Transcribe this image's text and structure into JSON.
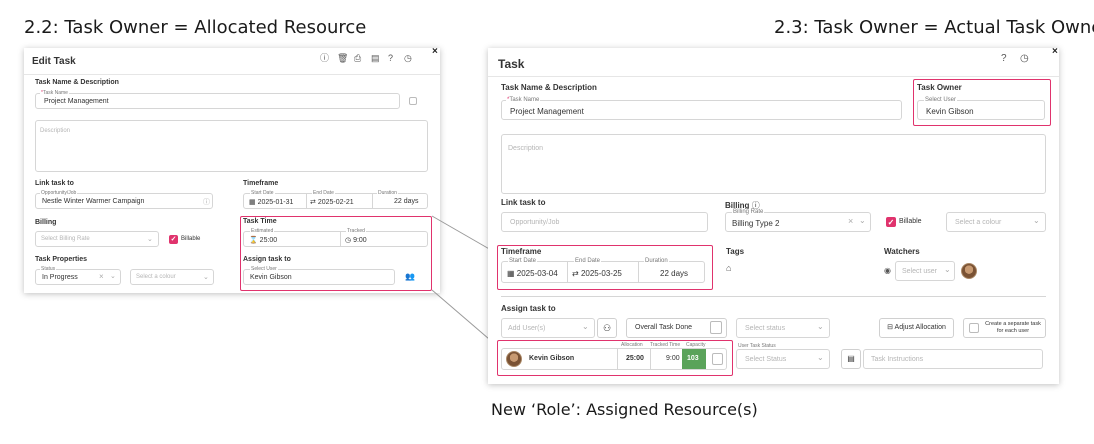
{
  "headings": {
    "left": "2.2: Task Owner = Allocated Resource",
    "right": "2.3: Task Owner = Actual Task Owner",
    "caption": "New ‘Role’: Assigned Resource(s)"
  },
  "left_panel": {
    "title": "Edit Task",
    "close": "×",
    "toolbar_icons": [
      "info-icon",
      "trash-icon",
      "print-icon",
      "clipboard-icon",
      "help-icon",
      "history-icon"
    ],
    "task_name_section": "Task Name & Description",
    "task_name_label": "Task Name",
    "task_name_value": "Project Management",
    "description_placeholder": "Description",
    "link_task_label": "Link task to",
    "opportunity_label": "Opportunity/Job",
    "opportunity_value": "Nestle Winter Warmer Campaign",
    "timeframe_label": "Timeframe",
    "start_date_label": "Start Date",
    "start_date_value": "2025-01-31",
    "end_date_label": "End Date",
    "end_date_value": "2025-02-21",
    "duration_label": "Duration",
    "duration_value": "22 days",
    "billing_label": "Billing",
    "billing_rate_placeholder": "Select Billing Rate",
    "billable_label": "Billable",
    "task_time_label": "Task Time",
    "estimated_label": "Estimated",
    "estimated_value": "25:00",
    "tracked_label": "Tracked",
    "tracked_value": "9:00",
    "task_properties_label": "Task Properties",
    "status_label": "Status",
    "status_value": "In Progress",
    "colour_placeholder": "Select a colour",
    "assign_label": "Assign task to",
    "select_user_label": "Select User",
    "assignee_value": "Kevin Gibson"
  },
  "right_panel": {
    "title": "Task",
    "close": "×",
    "toolbar_icons": [
      "help-icon",
      "history-icon"
    ],
    "task_name_section": "Task Name & Description",
    "task_name_label": "Task Name",
    "task_name_value": "Project Management",
    "task_owner_label": "Task Owner",
    "select_user_label": "Select User",
    "task_owner_value": "Kevin Gibson",
    "description_placeholder": "Description",
    "link_task_label": "Link task to",
    "opportunity_placeholder": "Opportunity/Job",
    "billing_label": "Billing",
    "billing_rate_label": "Billing Rate",
    "billing_rate_value": "Billing Type 2",
    "billable_label": "Billable",
    "colour_placeholder": "Select a colour",
    "timeframe_label": "Timeframe",
    "start_date_label": "Start Date",
    "start_date_value": "2025-03-04",
    "end_date_label": "End Date",
    "end_date_value": "2025-03-25",
    "duration_label": "Duration",
    "duration_value": "22 days",
    "tags_label": "Tags",
    "watchers_label": "Watchers",
    "watchers_placeholder": "Select user",
    "assign_label": "Assign task to",
    "add_users_placeholder": "Add User(s)",
    "overall_done_label": "Overall Task Done",
    "select_status_placeholder": "Select status",
    "adjust_allocation_label": "Adjust Allocation",
    "separate_task_label": "Create a separate task for each user",
    "allocation_header": "Allocation",
    "tracked_time_header": "Tracked Time",
    "capacity_header": "Capacity",
    "user_task_status_label": "User Task Status",
    "resource_name": "Kevin Gibson",
    "allocation_value": "25:00",
    "tracked_time_value": "9:00",
    "capacity_value": "103",
    "user_status_placeholder": "Select Status",
    "task_instructions_placeholder": "Task Instructions"
  },
  "colors": {
    "highlight": "#e0336d",
    "capacity_green": "#5aa35a",
    "connector": "#9a9a9a"
  }
}
